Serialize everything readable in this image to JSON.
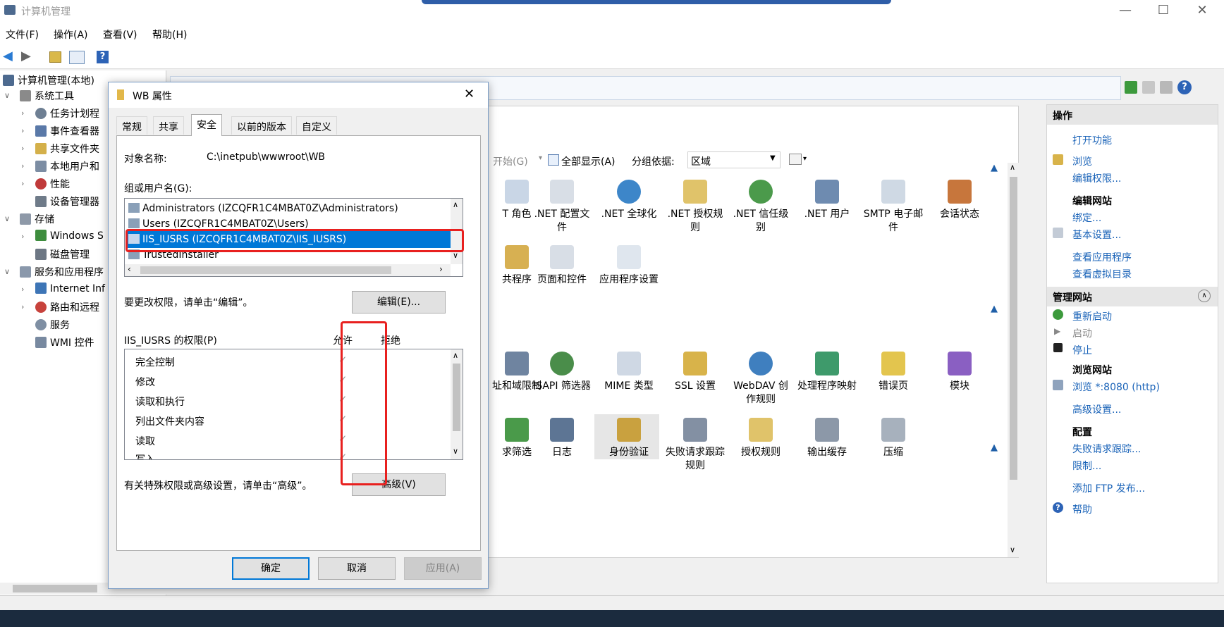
{
  "window": {
    "title": "计算机管理",
    "controls": {
      "minimize": "—",
      "maximize": "☐",
      "close": "✕"
    }
  },
  "menubar": {
    "items": [
      "文件(F)",
      "操作(A)",
      "查看(V)",
      "帮助(H)"
    ]
  },
  "tree": {
    "root": "计算机管理(本地)",
    "items": [
      "系统工具",
      "任务计划程",
      "事件查看器",
      "共享文件夹",
      "本地用户和",
      "性能",
      "设备管理器",
      "存储",
      "Windows S",
      "磁盘管理",
      "服务和应用程序",
      "Internet Inf",
      "路由和远程",
      "服务",
      "WMI 控件"
    ]
  },
  "iis": {
    "toolbar": {
      "start": "开始(G)",
      "show_all": "全部显示(A)",
      "group_by_label": "分组依据:",
      "group_by_value": "区域"
    },
    "features": [
      {
        "label": "T 角色",
        "icon": "roles-icon"
      },
      {
        "label": ".NET 配置文件",
        "icon": "net-profile-icon"
      },
      {
        "label": ".NET 全球化",
        "icon": "globe-icon"
      },
      {
        "label": ".NET 授权规则",
        "icon": "lock-doc-icon"
      },
      {
        "label": ".NET 信任级别",
        "icon": "trust-icon"
      },
      {
        "label": ".NET 用户",
        "icon": "user-icon"
      },
      {
        "label": "SMTP 电子邮件",
        "icon": "mail-icon"
      },
      {
        "label": "会话状态",
        "icon": "session-icon"
      },
      {
        "label": "共程序",
        "icon": "provider-icon"
      },
      {
        "label": "页面和控件",
        "icon": "pages-icon"
      },
      {
        "label": "应用程序设置",
        "icon": "app-settings-icon"
      },
      {
        "label": "址和域限制",
        "icon": "ip-restrict-icon"
      },
      {
        "label": "ISAPI 筛选器",
        "icon": "isapi-icon"
      },
      {
        "label": "MIME 类型",
        "icon": "mime-icon"
      },
      {
        "label": "SSL 设置",
        "icon": "ssl-lock-icon"
      },
      {
        "label": "WebDAV 创作规则",
        "icon": "webdav-icon"
      },
      {
        "label": "处理程序映射",
        "icon": "handler-icon"
      },
      {
        "label": "错误页",
        "icon": "error-page-icon"
      },
      {
        "label": "模块",
        "icon": "modules-icon"
      },
      {
        "label": "求筛选",
        "icon": "request-filter-icon"
      },
      {
        "label": "日志",
        "icon": "log-icon"
      },
      {
        "label": "身份验证",
        "icon": "auth-icon"
      },
      {
        "label": "失败请求跟踪规则",
        "icon": "failed-trace-icon"
      },
      {
        "label": "授权规则",
        "icon": "authz-icon"
      },
      {
        "label": "输出缓存",
        "icon": "output-cache-icon"
      },
      {
        "label": "压缩",
        "icon": "compress-icon"
      }
    ]
  },
  "actions": {
    "header": "操作",
    "open_feature": "打开功能",
    "browse": "浏览",
    "edit_permissions": "编辑权限...",
    "edit_site_title": "编辑网站",
    "bindings": "绑定...",
    "basic_settings": "基本设置...",
    "view_apps": "查看应用程序",
    "view_vdirs": "查看虚拟目录",
    "manage_site_title": "管理网站",
    "restart": "重新启动",
    "start": "启动",
    "stop": "停止",
    "browse_site_title": "浏览网站",
    "browse_8080": "浏览 *:8080 (http)",
    "advanced_settings": "高级设置...",
    "config_title": "配置",
    "failed_request_tracing": "失败请求跟踪...",
    "limits": "限制...",
    "add_ftp": "添加 FTP 发布...",
    "help": "帮助"
  },
  "dialog": {
    "title": "WB 属性",
    "close": "✕",
    "tabs": [
      "常规",
      "共享",
      "安全",
      "以前的版本",
      "自定义"
    ],
    "active_tab": "安全",
    "object_name_label": "对象名称:",
    "object_name_value": "C:\\inetpub\\wwwroot\\WB",
    "groups_label": "组或用户名(G):",
    "groups": [
      "Administrators (IZCQFR1C4MBAT0Z\\Administrators)",
      "Users (IZCQFR1C4MBAT0Z\\Users)",
      "IIS_IUSRS (IZCQFR1C4MBAT0Z\\IIS_IUSRS)",
      "TrustedInstaller"
    ],
    "selected_group": "IIS_IUSRS (IZCQFR1C4MBAT0Z\\IIS_IUSRS)",
    "change_hint": "要更改权限，请单击“编辑”。",
    "edit_button": "编辑(E)...",
    "perm_label": "IIS_IUSRS 的权限(P)",
    "allow_header": "允许",
    "deny_header": "拒绝",
    "permissions": [
      {
        "name": "完全控制",
        "allow": "✓",
        "deny": ""
      },
      {
        "name": "修改",
        "allow": "✓",
        "deny": ""
      },
      {
        "name": "读取和执行",
        "allow": "✓",
        "deny": ""
      },
      {
        "name": "列出文件夹内容",
        "allow": "✓",
        "deny": ""
      },
      {
        "name": "读取",
        "allow": "✓",
        "deny": ""
      },
      {
        "name": "写入",
        "allow": "✓",
        "deny": ""
      }
    ],
    "advanced_hint": "有关特殊权限或高级设置，请单击“高级”。",
    "advanced_button": "高级(V)",
    "ok": "确定",
    "cancel": "取消",
    "apply": "应用(A)"
  },
  "colors": {
    "highlight": "#0078d7",
    "annotation": "#e8201f",
    "link": "#1a63b8"
  }
}
